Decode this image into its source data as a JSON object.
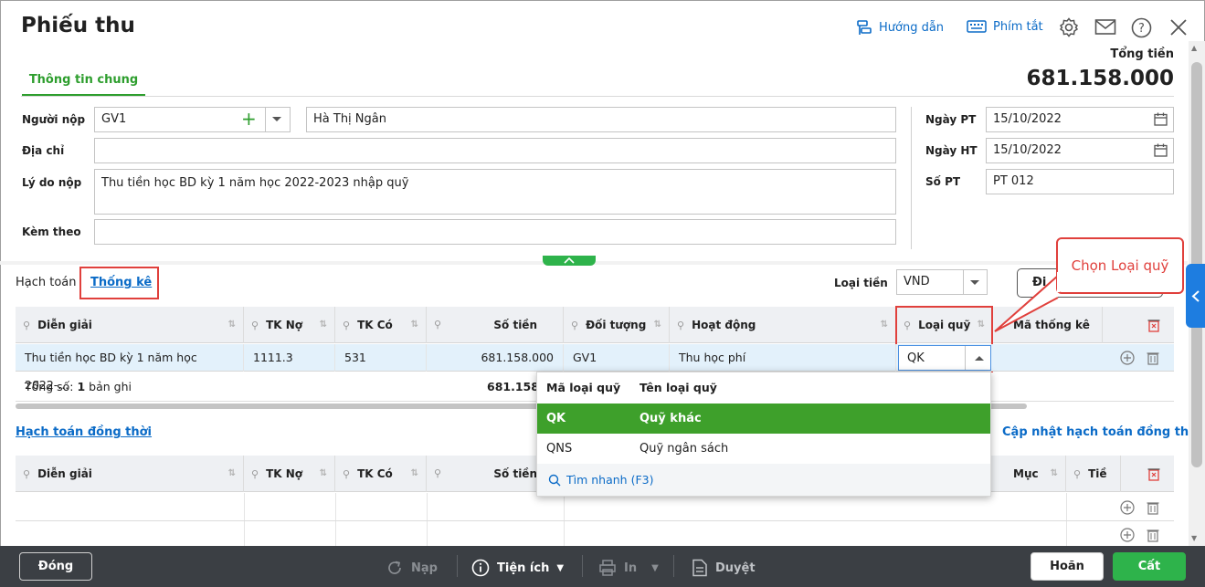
{
  "header": {
    "title": "Phiếu thu",
    "help_label": "Hướng dẫn",
    "shortcut_label": "Phím tắt",
    "total_label": "Tổng tiền",
    "total_value": "681.158.000"
  },
  "tabs": {
    "general": "Thông tin chung"
  },
  "form": {
    "payer_label": "Người nộp",
    "payer_code": "GV1",
    "payer_name": "Hà Thị Ngân",
    "address_label": "Địa chỉ",
    "address_value": "",
    "reason_label": "Lý do nộp",
    "reason_value": "Thu tiền học BD kỳ 1 năm học 2022-2023 nhập quỹ",
    "attach_label": "Kèm theo",
    "attach_value": "",
    "date_pt_label": "Ngày PT",
    "date_pt": "15/10/2022",
    "date_ht_label": "Ngày HT",
    "date_ht": "15/10/2022",
    "so_pt_label": "Số PT",
    "so_pt": "PT 012"
  },
  "section": {
    "hach_toan": "Hạch toán",
    "thong_ke": "Thống kê",
    "currency_label": "Loại tiền",
    "currency": "VND",
    "partial_button": "Đi"
  },
  "grid1": {
    "columns": [
      "Diễn giải",
      "TK Nợ",
      "TK Có",
      "Số tiền",
      "Đối tượng",
      "Hoạt động",
      "Loại quỹ",
      "Mã thống kê"
    ],
    "row": {
      "dien_giai": "Thu tiền học BD kỳ 1 năm học 2022-...",
      "tk_no": "1111.3",
      "tk_co": "531",
      "so_tien": "681.158.000",
      "doi_tuong": "GV1",
      "hoat_dong": "Thu học phí",
      "loai_quy": "QK"
    },
    "summary_prefix": "Tổng số: ",
    "summary_count": "1",
    "summary_suffix": " bản ghi",
    "summary_total": "681.158."
  },
  "dropdown": {
    "col_code": "Mã loại quỹ",
    "col_name": "Tên loại quỹ",
    "items": [
      {
        "code": "QK",
        "name": "Quỹ khác"
      },
      {
        "code": "QNS",
        "name": "Quỹ ngân sách"
      }
    ],
    "search": "Tìm nhanh (F3)"
  },
  "concurrent": {
    "title": "Hạch toán đồng thời",
    "update_link": "Cập nhật hạch toán đồng thời",
    "columns": [
      "Diễn giải",
      "TK Nợ",
      "TK Có",
      "Số tiền",
      "Mục",
      "Tiề"
    ]
  },
  "callout": "Chọn Loại quỹ",
  "footer": {
    "close": "Đóng",
    "reload": "Nạp",
    "utility": "Tiện ích",
    "print": "In",
    "approve": "Duyệt",
    "cancel": "Hoãn",
    "save": "Cất"
  },
  "colors": {
    "accent_green": "#2e9e2e",
    "link_blue": "#0b6bc7",
    "highlight_red": "#e0403c",
    "selected_row": "#3ea02b"
  }
}
